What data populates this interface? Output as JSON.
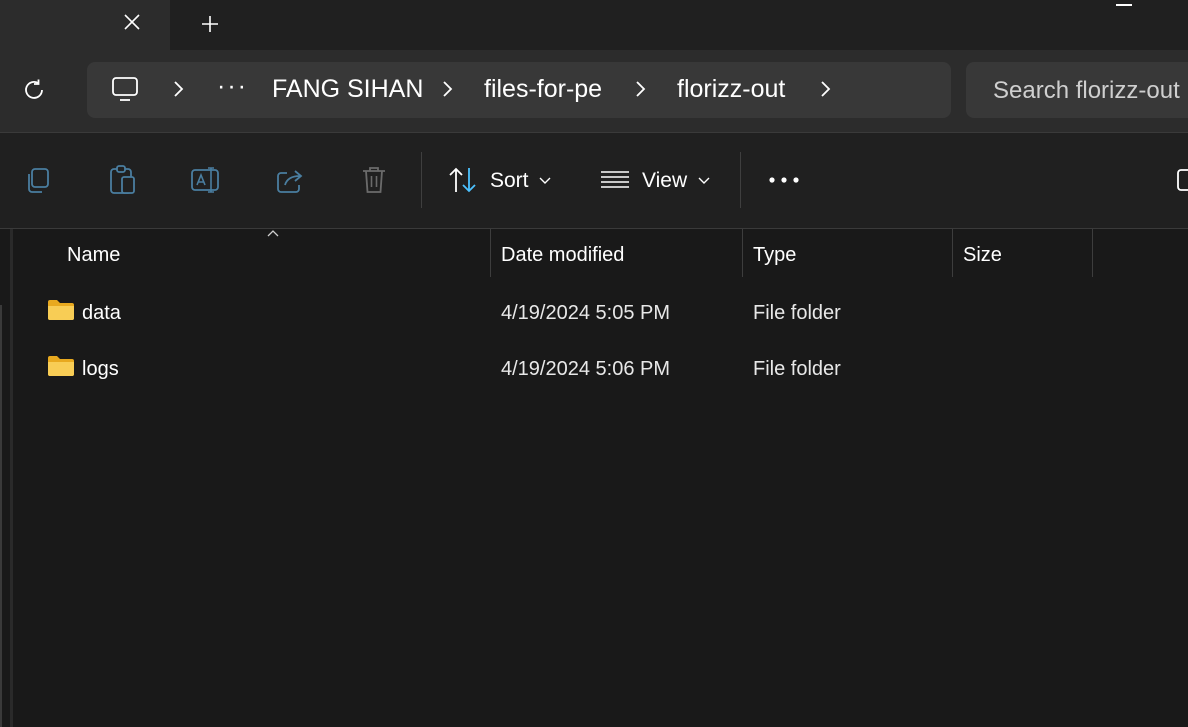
{
  "window": {
    "new_tab_icon": "plus-icon",
    "close_tab_icon": "close-icon"
  },
  "address_bar": {
    "breadcrumb": [
      "FANG SIHAN",
      "files-for-pe",
      "florizz-out"
    ],
    "overflow": "···",
    "search_placeholder": "Search florizz-out"
  },
  "command_bar": {
    "sort_label": "Sort",
    "view_label": "View",
    "more": "•••"
  },
  "file_list": {
    "columns": [
      "Name",
      "Date modified",
      "Type",
      "Size"
    ],
    "rows": [
      {
        "name": "data",
        "date": "4/19/2024 5:05 PM",
        "type": "File folder",
        "size": ""
      },
      {
        "name": "logs",
        "date": "4/19/2024 5:06 PM",
        "type": "File folder",
        "size": ""
      }
    ]
  },
  "colors": {
    "folder": "#f5c74a",
    "accent": "#4cc2ff"
  }
}
